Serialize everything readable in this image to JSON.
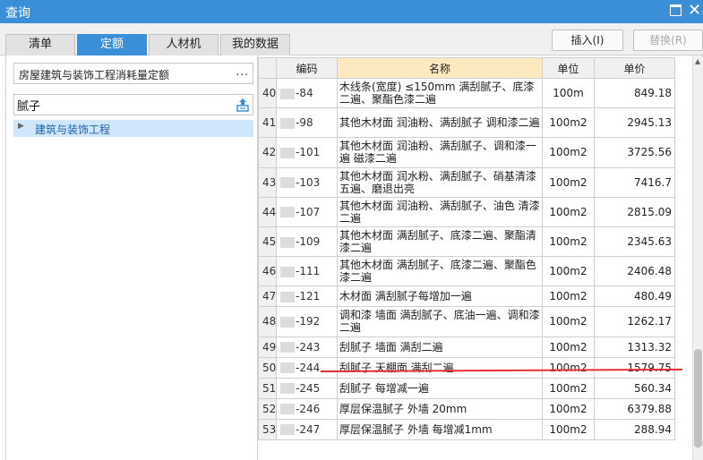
{
  "window": {
    "title": "查询"
  },
  "tabs": [
    {
      "label": "清单",
      "active": false
    },
    {
      "label": "定额",
      "active": true
    },
    {
      "label": "人材机",
      "active": false
    },
    {
      "label": "我的数据",
      "active": false
    }
  ],
  "toolbar": {
    "insert_label": "插入(I)",
    "replace_label": "替换(R)"
  },
  "left": {
    "quota_name": "房屋建筑与装饰工程消耗量定额",
    "more_label": "...",
    "search_value": "腻子",
    "tree_item": "建筑与装饰工程"
  },
  "grid": {
    "headers": {
      "code": "编码",
      "name": "名称",
      "unit": "单位",
      "price": "单价"
    },
    "rows": [
      {
        "idx": "40",
        "code": "-84",
        "name": "木线条(宽度) ≤150mm 满刮腻子、底漆二遍、聚酯色漆二遍",
        "unit": "100m",
        "price": "849.18"
      },
      {
        "idx": "41",
        "code": "-98",
        "name": "其他木材面 润油粉、满刮腻子 调和漆二遍",
        "unit": "100m2",
        "price": "2945.13"
      },
      {
        "idx": "42",
        "code": "-101",
        "name": "其他木材面 润油粉、满刮腻子、调和漆一遍 磁漆二遍",
        "unit": "100m2",
        "price": "3725.56"
      },
      {
        "idx": "43",
        "code": "-103",
        "name": "其他木材面 润水粉、满刮腻子、硝基清漆五遍、磨退出亮",
        "unit": "100m2",
        "price": "7416.7"
      },
      {
        "idx": "44",
        "code": "-107",
        "name": "其他木材面 润油粉、满刮腻子、油色 清漆二遍",
        "unit": "100m2",
        "price": "2815.09"
      },
      {
        "idx": "45",
        "code": "-109",
        "name": "其他木材面 满刮腻子、底漆二遍、聚酯清漆二遍",
        "unit": "100m2",
        "price": "2345.63"
      },
      {
        "idx": "46",
        "code": "-111",
        "name": "其他木材面 满刮腻子、底漆二遍、聚酯色漆二遍",
        "unit": "100m2",
        "price": "2406.48"
      },
      {
        "idx": "47",
        "code": "-121",
        "name": "木材面 满刮腻子每增加一遍",
        "unit": "100m2",
        "price": "480.49"
      },
      {
        "idx": "48",
        "code": "-192",
        "name": "调和漆 墙面 满刮腻子、底油一遍、调和漆二遍",
        "unit": "100m2",
        "price": "1262.17"
      },
      {
        "idx": "49",
        "code": "-243",
        "name": "刮腻子 墙面 满刮二遍",
        "unit": "100m2",
        "price": "1313.32"
      },
      {
        "idx": "50",
        "code": "-244",
        "name": "刮腻子 天棚面 满刮二遍",
        "unit": "100m2",
        "price": "1579.75"
      },
      {
        "idx": "51",
        "code": "-245",
        "name": "刮腻子 每增减一遍",
        "unit": "100m2",
        "price": "560.34"
      },
      {
        "idx": "52",
        "code": "-246",
        "name": "厚层保温腻子 外墙 20mm",
        "unit": "100m2",
        "price": "6379.88"
      },
      {
        "idx": "53",
        "code": "-247",
        "name": "厚层保温腻子 外墙 每增减1mm",
        "unit": "100m2",
        "price": "288.94"
      }
    ]
  },
  "colors": {
    "accent": "#3b8fd8",
    "header_highlight": "#fde9bf",
    "annotation": "#e53030"
  }
}
